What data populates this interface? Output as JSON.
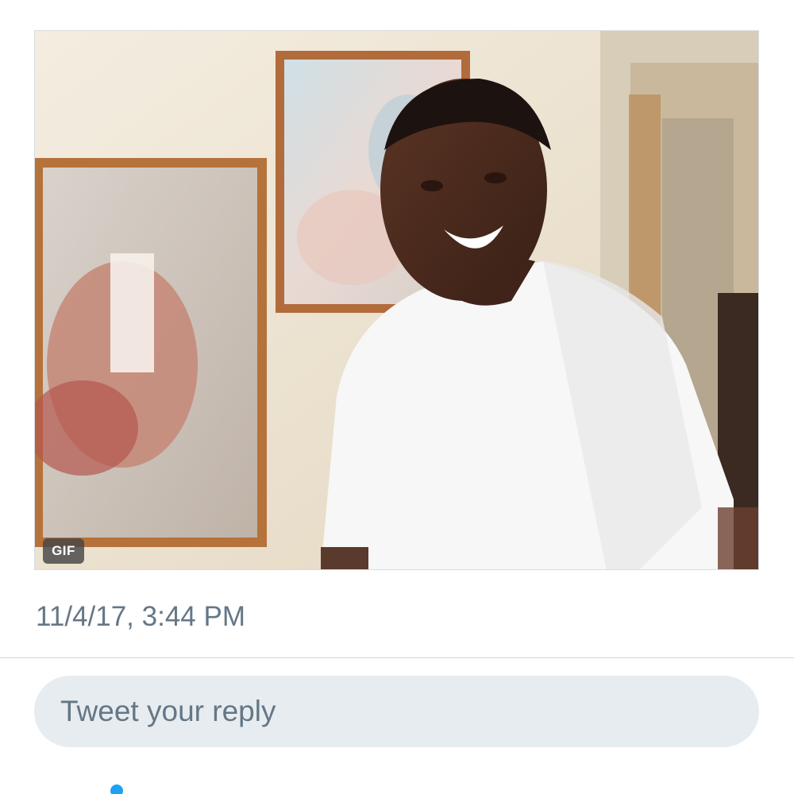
{
  "tweet": {
    "media": {
      "type_badge": "GIF",
      "description_icon": "gif-media"
    },
    "timestamp": "11/4/17, 3:44 PM"
  },
  "reply": {
    "placeholder": "Tweet your reply"
  },
  "colors": {
    "secondary_text": "#657786",
    "reply_background": "#e6ecf0",
    "divider": "#cfd6dc",
    "accent_blue": "#1da1f2",
    "badge_background": "#464646"
  }
}
